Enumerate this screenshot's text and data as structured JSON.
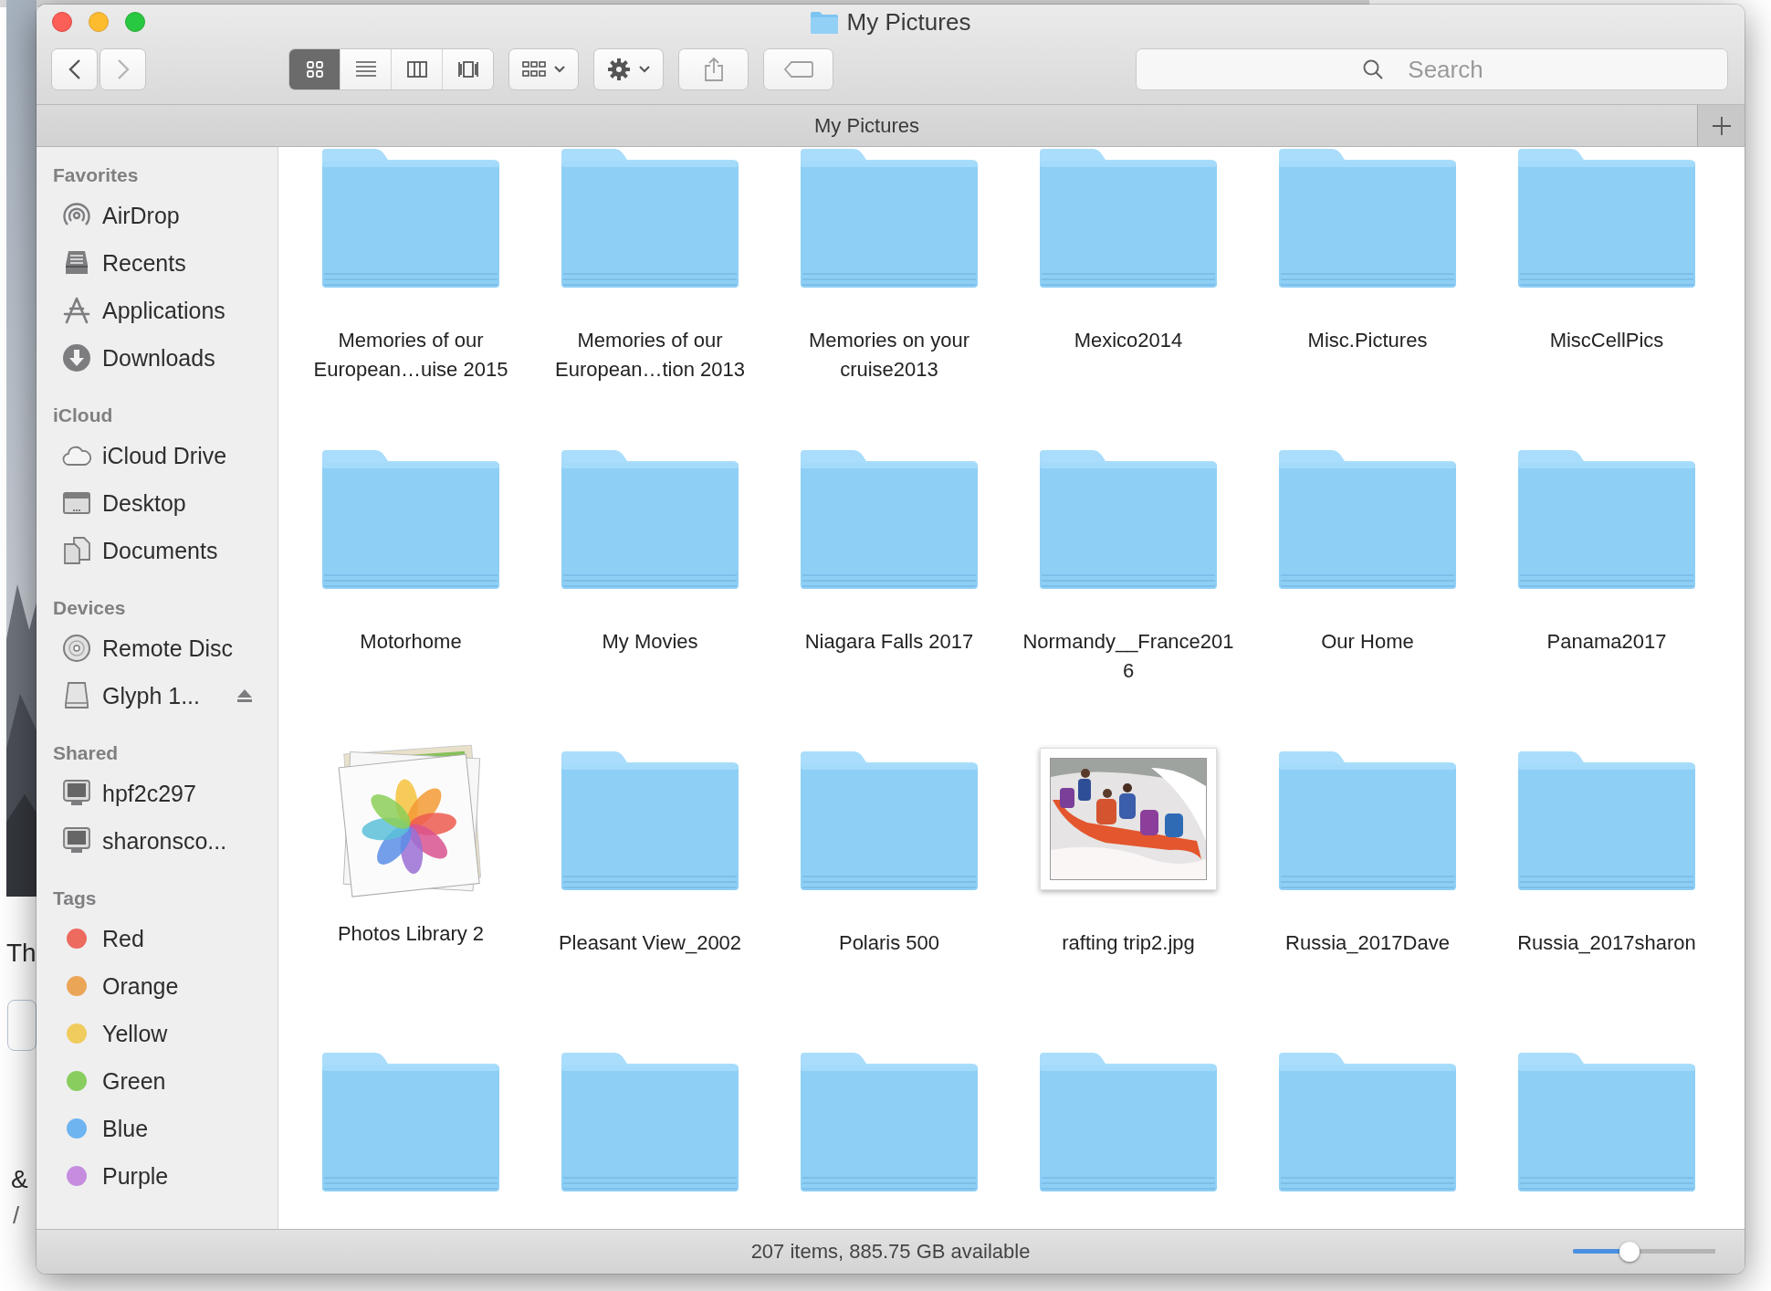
{
  "desktop": {
    "texts": [
      {
        "text": "Th",
        "kind": "label"
      },
      {
        "text": "&",
        "kind": "subheading"
      },
      {
        "text": "/",
        "kind": "caption"
      }
    ]
  },
  "window": {
    "title": "My Pictures"
  },
  "toolbar": {
    "views": [
      {
        "kind": "icon",
        "selected": true
      },
      {
        "kind": "list",
        "selected": false
      },
      {
        "kind": "columns",
        "selected": false
      },
      {
        "kind": "gallery",
        "selected": false
      }
    ],
    "search": {
      "placeholder": "Search"
    }
  },
  "path_bar": {
    "title": "My Pictures"
  },
  "sidebar": {
    "sections": [
      {
        "title": "Favorites",
        "items": [
          {
            "label": "AirDrop",
            "kind": "airdrop"
          },
          {
            "label": "Recents",
            "kind": "recents"
          },
          {
            "label": "Applications",
            "kind": "applications"
          },
          {
            "label": "Downloads",
            "kind": "downloads"
          }
        ]
      },
      {
        "title": "iCloud",
        "items": [
          {
            "label": "iCloud Drive",
            "kind": "cloud"
          },
          {
            "label": "Desktop",
            "kind": "desktop"
          },
          {
            "label": "Documents",
            "kind": "documents"
          }
        ]
      },
      {
        "title": "Devices",
        "items": [
          {
            "label": "Remote Disc",
            "kind": "disc"
          },
          {
            "label": "Glyph 1...",
            "kind": "drive",
            "eject": true
          }
        ]
      },
      {
        "title": "Shared",
        "items": [
          {
            "label": "hpf2c297",
            "kind": "computer"
          },
          {
            "label": "sharonsco...",
            "kind": "computer"
          }
        ]
      },
      {
        "title": "Tags",
        "items": [
          {
            "label": "Red",
            "kind": "tag",
            "color": "#ec6a5e"
          },
          {
            "label": "Orange",
            "kind": "tag",
            "color": "#eba556"
          },
          {
            "label": "Yellow",
            "kind": "tag",
            "color": "#f0cc5e"
          },
          {
            "label": "Green",
            "kind": "tag",
            "color": "#88cd5d"
          },
          {
            "label": "Blue",
            "kind": "tag",
            "color": "#6db4f0"
          },
          {
            "label": "Purple",
            "kind": "tag",
            "color": "#c68ddf"
          }
        ]
      }
    ]
  },
  "items": [
    {
      "name": "Memories of our European…uise 2015",
      "kind": "folder"
    },
    {
      "name": "Memories of our European…tion 2013",
      "kind": "folder"
    },
    {
      "name": "Memories on your cruise2013",
      "kind": "folder"
    },
    {
      "name": "Mexico2014",
      "kind": "folder"
    },
    {
      "name": "Misc.Pictures",
      "kind": "folder"
    },
    {
      "name": "MiscCellPics",
      "kind": "folder"
    },
    {
      "name": "Motorhome",
      "kind": "folder"
    },
    {
      "name": "My Movies",
      "kind": "folder"
    },
    {
      "name": "Niagara Falls 2017",
      "kind": "folder"
    },
    {
      "name": "Normandy__France2016",
      "kind": "folder"
    },
    {
      "name": "Our Home",
      "kind": "folder"
    },
    {
      "name": "Panama2017",
      "kind": "folder"
    },
    {
      "name": "Photos Library 2",
      "kind": "photos-library"
    },
    {
      "name": "Pleasant View_2002",
      "kind": "folder"
    },
    {
      "name": "Polaris 500",
      "kind": "folder"
    },
    {
      "name": "rafting trip2.jpg"
    },
    {
      "name": "Russia_2017Dave",
      "kind": "folder"
    },
    {
      "name": "Russia_2017sharon",
      "kind": "folder"
    },
    {
      "kind": "folder"
    },
    {
      "kind": "folder"
    },
    {
      "kind": "folder"
    },
    {
      "kind": "folder"
    },
    {
      "kind": "folder"
    },
    {
      "kind": "folder"
    }
  ],
  "status_bar": {
    "text": "207 items, 885.75 GB available",
    "zoom": {
      "level": 0.4
    }
  }
}
